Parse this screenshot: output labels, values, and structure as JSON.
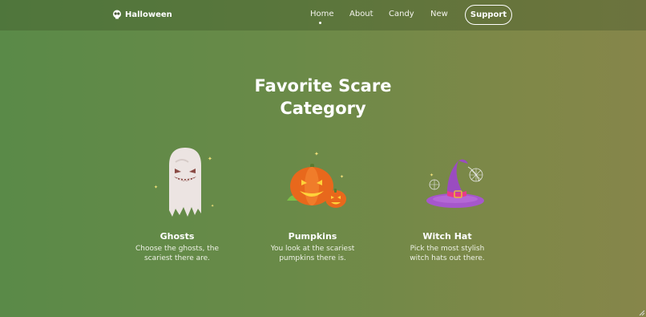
{
  "brand": {
    "name": "Halloween",
    "icon": "skull-icon"
  },
  "nav": {
    "items": [
      {
        "label": "Home",
        "active": true
      },
      {
        "label": "About"
      },
      {
        "label": "Candy"
      },
      {
        "label": "New"
      }
    ],
    "support_label": "Support"
  },
  "main": {
    "title_line1": "Favorite Scare",
    "title_line2": "Category",
    "cards": [
      {
        "title": "Ghosts",
        "desc_line1": "Choose the ghosts, the",
        "desc_line2": "scariest there are.",
        "icon": "ghost-icon"
      },
      {
        "title": "Pumpkins",
        "desc_line1": "You look at the scariest",
        "desc_line2": "pumpkins there is.",
        "icon": "pumpkin-icon"
      },
      {
        "title": "Witch Hat",
        "desc_line1": "Pick the most stylish",
        "desc_line2": "witch hats out there.",
        "icon": "witch-hat-icon"
      }
    ]
  },
  "colors": {
    "bg_left": "#5a8a48",
    "bg_right": "#86864a",
    "text": "#ffffff"
  }
}
